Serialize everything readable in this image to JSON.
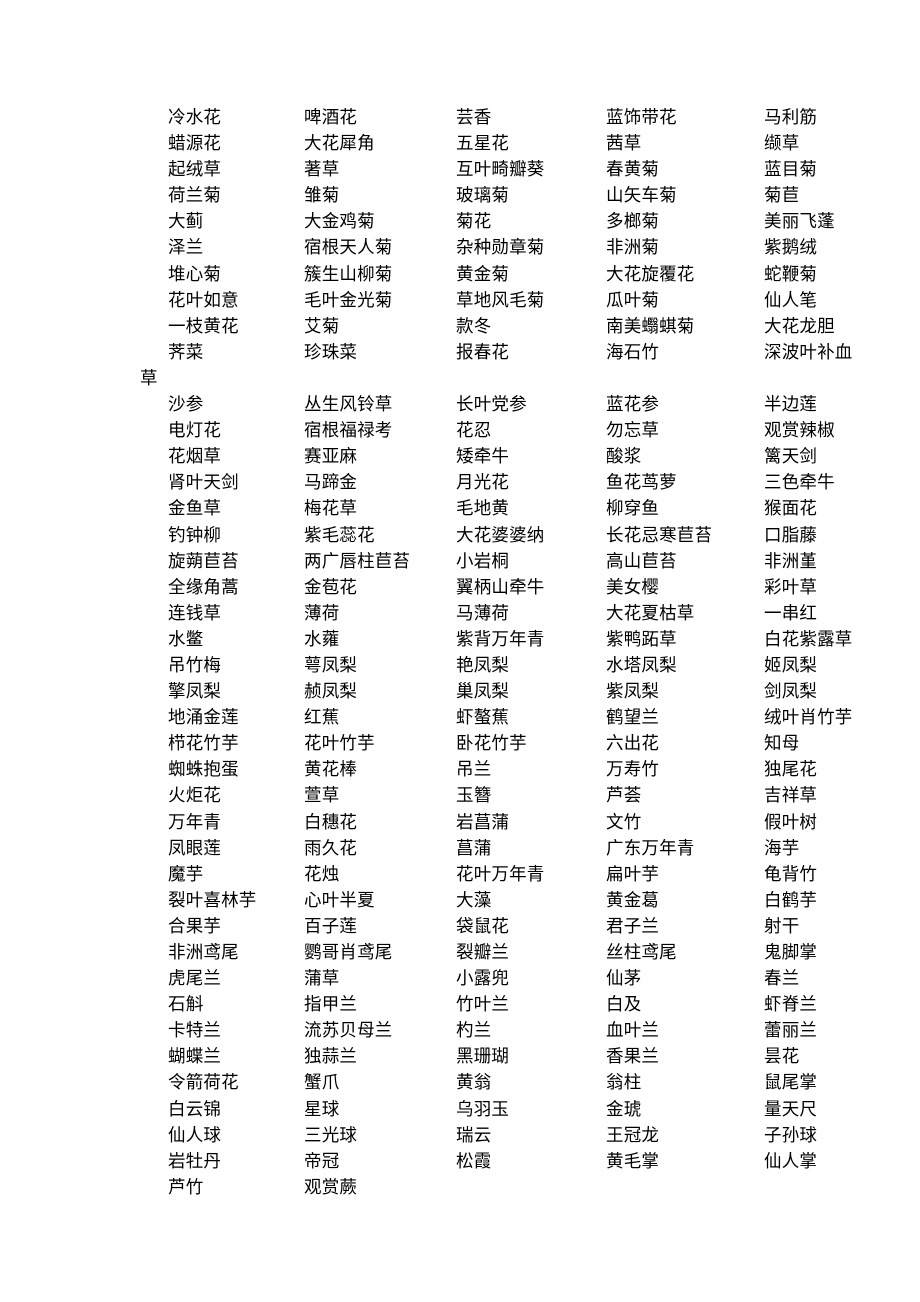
{
  "document": {
    "kind": "plant-name-list",
    "columns_per_row": 5,
    "background_color": "#ffffff",
    "text_color": "#000000"
  },
  "sections": [
    {
      "name": "section-one",
      "rows": [
        [
          "冷水花",
          "啤酒花",
          "芸香",
          "蓝饰带花",
          "马利筋"
        ],
        [
          "蜡源花",
          "大花犀角",
          "五星花",
          "茜草",
          "缬草"
        ],
        [
          "起绒草",
          "著草",
          "互叶畸瓣葵",
          "春黄菊",
          "蓝目菊"
        ],
        [
          "荷兰菊",
          "雏菊",
          "玻璃菊",
          "山矢车菊",
          "菊苣"
        ],
        [
          "大蓟",
          "大金鸡菊",
          "菊花",
          "多榔菊",
          "美丽飞蓬"
        ],
        [
          "泽兰",
          "宿根天人菊",
          "杂种勋章菊",
          "非洲菊",
          "紫鹅绒"
        ],
        [
          "堆心菊",
          "簇生山柳菊",
          "黄金菊",
          "大花旋覆花",
          "蛇鞭菊"
        ],
        [
          "花叶如意",
          "毛叶金光菊",
          "草地风毛菊",
          "瓜叶菊",
          "仙人笔"
        ],
        [
          "一枝黄花",
          "艾菊",
          "款冬",
          "南美蠮蜞菊",
          "大花龙胆"
        ],
        [
          "荠菜",
          "珍珠菜",
          "报春花",
          "海石竹",
          "深波叶补血"
        ]
      ],
      "wrapped_continuation": "草"
    },
    {
      "name": "section-two",
      "rows": [
        [
          "沙参",
          "丛生风铃草",
          "长叶党参",
          "蓝花参",
          "半边莲"
        ],
        [
          "电灯花",
          "宿根福禄考",
          "花忍",
          "勿忘草",
          "观赏辣椒"
        ],
        [
          "花烟草",
          "赛亚麻",
          "矮牵牛",
          "酸浆",
          "篱天剑"
        ],
        [
          "肾叶天剑",
          "马蹄金",
          "月光花",
          "鱼花茑萝",
          "三色牵牛"
        ],
        [
          "金鱼草",
          "梅花草",
          "毛地黄",
          "柳穿鱼",
          "猴面花"
        ],
        [
          "钓钟柳",
          "紫毛蕊花",
          "大花婆婆纳",
          "长花忌寒苣苔",
          "口脂藤"
        ],
        [
          "旋蒴苣苔",
          "两广唇柱苣苔",
          "小岩桐",
          "高山苣苔",
          "非洲堇"
        ],
        [
          "全缘角蒿",
          "金苞花",
          "翼柄山牵牛",
          "美女樱",
          "彩叶草"
        ],
        [
          "连钱草",
          "薄荷",
          "马薄荷",
          "大花夏枯草",
          "一串红"
        ],
        [
          "水鳖",
          "水蕹",
          "紫背万年青",
          "紫鸭跖草",
          "白花紫露草"
        ],
        [
          "吊竹梅",
          "萼凤梨",
          "艳凤梨",
          "水塔凤梨",
          "姬凤梨"
        ],
        [
          "擎凤梨",
          "赪凤梨",
          "巢凤梨",
          "紫凤梨",
          "剑凤梨"
        ],
        [
          "地涌金莲",
          "红蕉",
          "虾螯蕉",
          "鹤望兰",
          "绒叶肖竹芋"
        ],
        [
          "栉花竹芋",
          "花叶竹芋",
          "卧花竹芋",
          "六出花",
          "知母"
        ],
        [
          "蜘蛛抱蛋",
          "黄花棒",
          "吊兰",
          "万寿竹",
          "独尾花"
        ],
        [
          "火炬花",
          "萱草",
          "玉簪",
          "芦荟",
          "吉祥草"
        ],
        [
          "万年青",
          "白穗花",
          "岩菖蒲",
          "文竹",
          "假叶树"
        ],
        [
          "凤眼莲",
          "雨久花",
          "菖蒲",
          "广东万年青",
          "海芋"
        ],
        [
          "魔芋",
          "花烛",
          "花叶万年青",
          "扁叶芋",
          "龟背竹"
        ],
        [
          "裂叶喜林芋",
          "心叶半夏",
          "大藻",
          "黄金葛",
          "白鹤芋"
        ],
        [
          "合果芋",
          "百子莲",
          "袋鼠花",
          "君子兰",
          "射干"
        ],
        [
          "非洲鸢尾",
          "鹦哥肖鸢尾",
          "裂瓣兰",
          "丝柱鸢尾",
          "鬼脚掌"
        ],
        [
          "虎尾兰",
          "蒲草",
          "小露兜",
          "仙茅",
          "春兰"
        ],
        [
          "石斛",
          "指甲兰",
          "竹叶兰",
          "白及",
          "虾脊兰"
        ],
        [
          "卡特兰",
          "流苏贝母兰",
          "杓兰",
          "血叶兰",
          "蕾丽兰"
        ],
        [
          "蝴蝶兰",
          "独蒜兰",
          "黑珊瑚",
          "香果兰",
          "昙花"
        ],
        [
          "令箭荷花",
          "蟹爪",
          "黄翁",
          "翁柱",
          "鼠尾掌"
        ],
        [
          "白云锦",
          "星球",
          "乌羽玉",
          "金琥",
          "量天尺"
        ],
        [
          "仙人球",
          "三光球",
          "瑞云",
          "王冠龙",
          "子孙球"
        ],
        [
          "岩牡丹",
          "帝冠",
          "松霞",
          "黄毛掌",
          "仙人掌"
        ],
        [
          "芦竹",
          "观赏蕨",
          "",
          "",
          ""
        ]
      ]
    }
  ]
}
